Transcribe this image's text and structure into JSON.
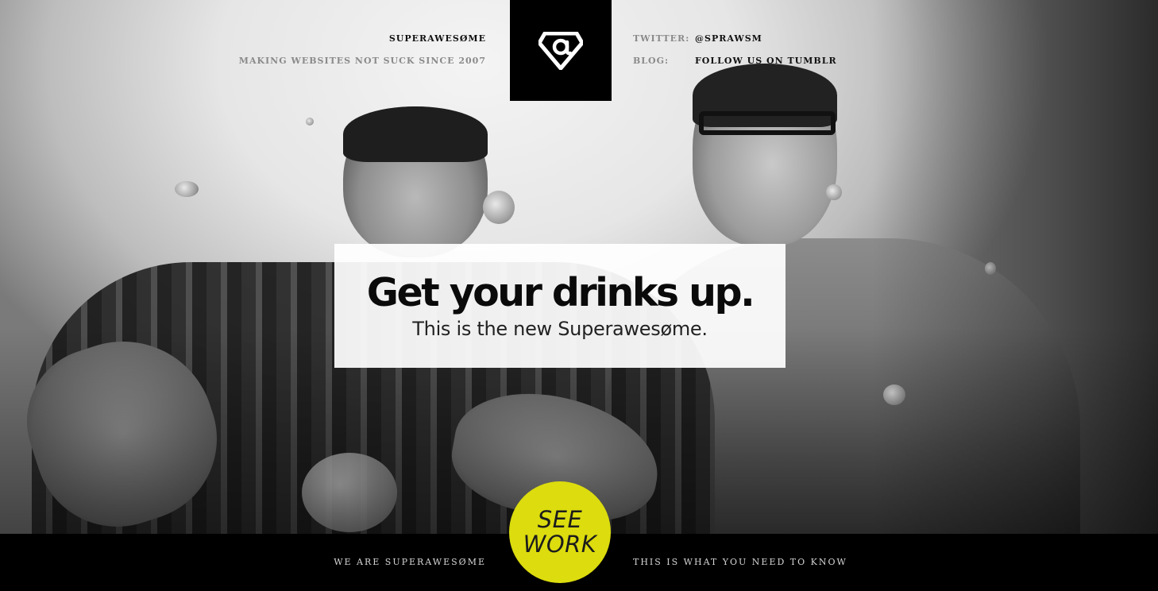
{
  "header": {
    "brand_name": "SUPERAWESØME",
    "tagline": "MAKING WEBSITES NOT SUCK SINCE 2007",
    "logo_icon": "superhero-at-sign-logo-icon",
    "twitter_label": "TWITTER:",
    "twitter_value": "@SPRAWSM",
    "blog_label": "BLOG:",
    "blog_value": "FOLLOW US ON TUMBLR"
  },
  "hero": {
    "headline": "Get your drinks up.",
    "subheadline": "This is the new Superawesøme."
  },
  "cta": {
    "line1": "SEE",
    "line2": "WORK",
    "color": "#dcdc0e"
  },
  "footer": {
    "left_link": "WE ARE SUPERAWESØME",
    "right_link": "THIS IS WHAT YOU NEED TO KNOW"
  }
}
